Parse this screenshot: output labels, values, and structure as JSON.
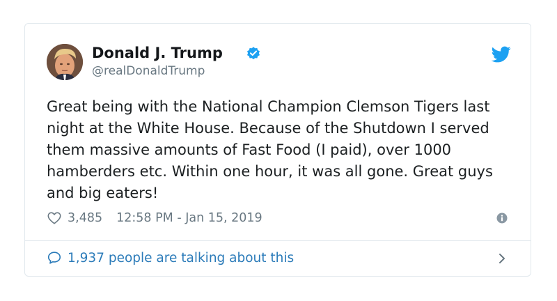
{
  "author": {
    "name": "Donald J. Trump",
    "handle": "@realDonaldTrump",
    "verified": true,
    "avatar_icon": "profile-photo"
  },
  "tweet": {
    "text": "Great being with the National Champion Clemson Tigers last night at the White House. Because of the Shutdown I served them massive amounts of Fast Food (I paid), over 1000 hamberders etc. Within one hour, it was all gone. Great guys and big eaters!",
    "likes": "3,485",
    "timestamp": "12:58 PM - Jan 15, 2019"
  },
  "footer": {
    "talking_label": "1,937 people are talking about this"
  },
  "icons": {
    "brand": "twitter-bird-icon",
    "like": "heart-icon",
    "info": "info-icon",
    "reply": "speech-bubble-icon",
    "open": "chevron-right-icon"
  },
  "colors": {
    "twitter_blue": "#1da1f2",
    "link_blue": "#2b7bb9",
    "muted_text": "#697882",
    "border": "#e1e8ed"
  }
}
